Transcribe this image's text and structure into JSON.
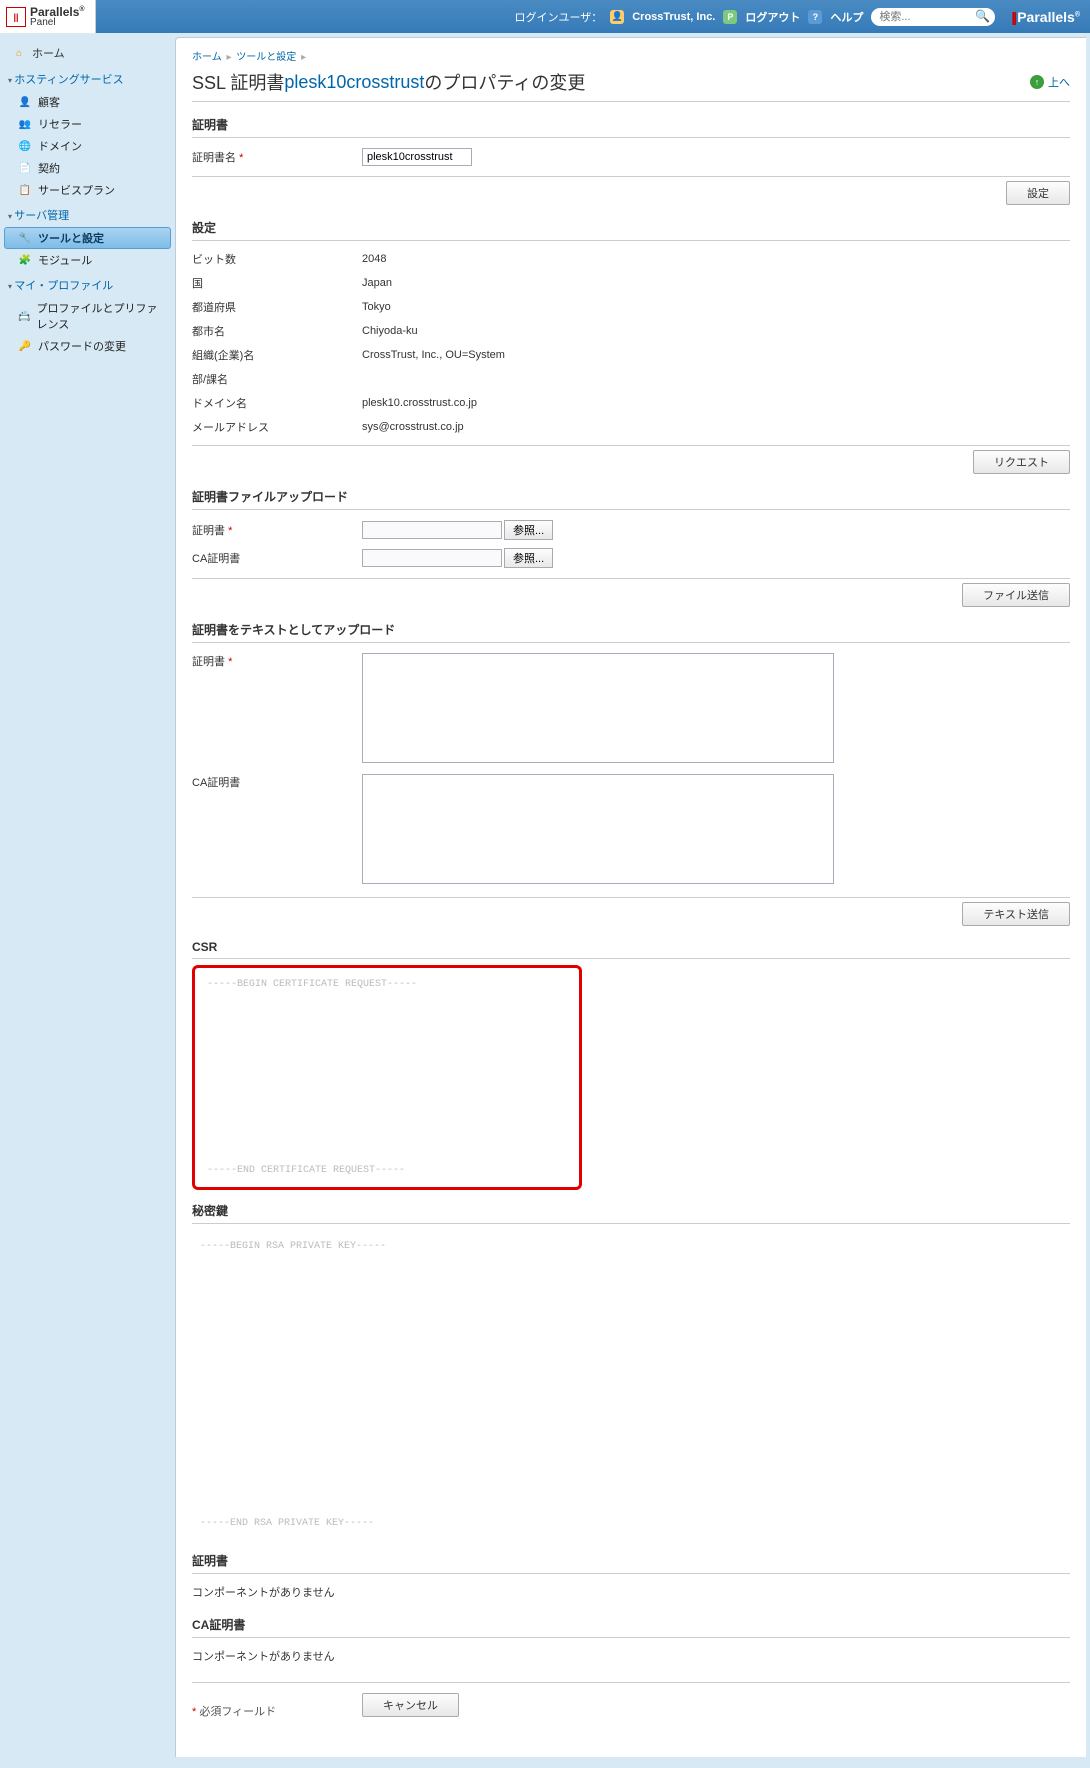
{
  "topbar": {
    "login_user_label": "ログインユーザ：",
    "company": "CrossTrust, Inc.",
    "logout": "ログアウト",
    "help": "ヘルプ",
    "search_placeholder": "検索...",
    "brand": "Parallels"
  },
  "logo": {
    "main": "Parallels",
    "sub": "Panel"
  },
  "sidebar": {
    "home": "ホーム",
    "sections": {
      "hosting": {
        "title": "ホスティングサービス",
        "items": [
          "顧客",
          "リセラー",
          "ドメイン",
          "契約",
          "サービスプラン"
        ]
      },
      "server": {
        "title": "サーバ管理",
        "items": [
          "ツールと設定",
          "モジュール"
        ]
      },
      "profile": {
        "title": "マイ・プロファイル",
        "items": [
          "プロファイルとプリファレンス",
          "パスワードの変更"
        ]
      }
    }
  },
  "breadcrumb": {
    "home": "ホーム",
    "tools": "ツールと設定"
  },
  "page": {
    "title_prefix": "SSL 証明書 ",
    "cert_name": "plesk10crosstrust",
    "title_suffix": " のプロパティの変更",
    "up": "上へ"
  },
  "s_cert": {
    "heading": "証明書",
    "name_label": "証明書名",
    "name_value": "plesk10crosstrust",
    "settings_btn": "設定"
  },
  "s_settings": {
    "heading": "設定",
    "rows": [
      {
        "label": "ビット数",
        "value": "2048"
      },
      {
        "label": "国",
        "value": "Japan"
      },
      {
        "label": "都道府県",
        "value": "Tokyo"
      },
      {
        "label": "都市名",
        "value": "Chiyoda-ku"
      },
      {
        "label": "組織(企業)名",
        "value": "CrossTrust, Inc., OU=System"
      },
      {
        "label": "部/課名",
        "value": ""
      },
      {
        "label": "ドメイン名",
        "value": "plesk10.crosstrust.co.jp"
      },
      {
        "label": "メールアドレス",
        "value": "sys@crosstrust.co.jp"
      }
    ],
    "request_btn": "リクエスト"
  },
  "s_upload": {
    "heading": "証明書ファイルアップロード",
    "cert_label": "証明書",
    "ca_label": "CA証明書",
    "browse": "参照...",
    "send_btn": "ファイル送信"
  },
  "s_text": {
    "heading": "証明書をテキストとしてアップロード",
    "cert_label": "証明書",
    "ca_label": "CA証明書",
    "send_btn": "テキスト送信"
  },
  "s_csr": {
    "heading": "CSR",
    "begin": "-----BEGIN CERTIFICATE REQUEST-----",
    "end": "-----END CERTIFICATE REQUEST-----"
  },
  "s_key": {
    "heading": "秘密鍵",
    "begin": "-----BEGIN RSA PRIVATE KEY-----",
    "end": "-----END RSA PRIVATE KEY-----"
  },
  "s_cert2": {
    "heading": "証明書",
    "msg": "コンポーネントがありません"
  },
  "s_ca2": {
    "heading": "CA証明書",
    "msg": "コンポーネントがありません"
  },
  "footer": {
    "required": "必須フィールド",
    "cancel": "キャンセル"
  }
}
